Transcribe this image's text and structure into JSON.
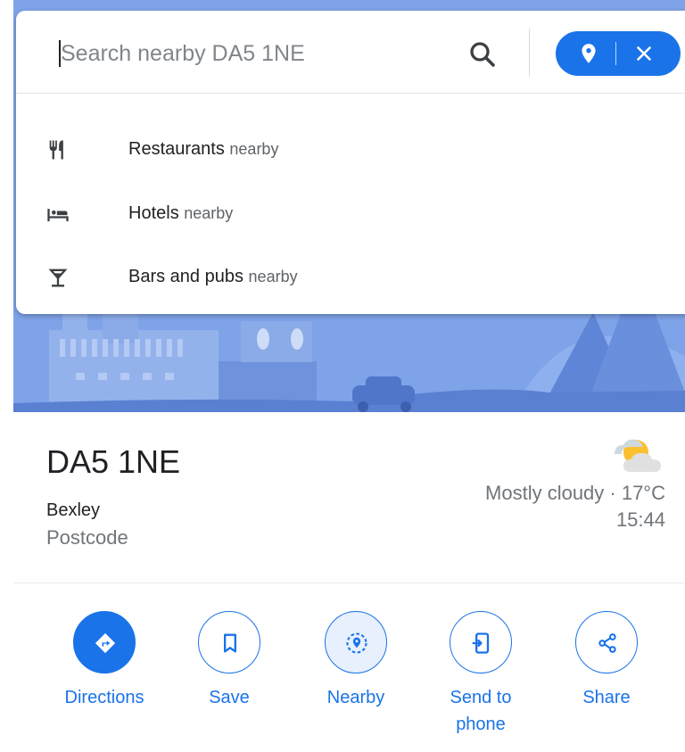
{
  "colors": {
    "accent": "#1a73e8",
    "hero_sky": "#7fa3e8",
    "text_primary": "#202124",
    "text_secondary": "#70757a"
  },
  "search": {
    "placeholder": "Search nearby DA5 1NE",
    "value": "",
    "search_icon": "search-icon",
    "pin_icon": "location-pin-icon",
    "close_icon": "close-icon"
  },
  "suggestions": [
    {
      "icon": "restaurant-icon",
      "label": "Restaurants",
      "suffix": "nearby"
    },
    {
      "icon": "hotel-icon",
      "label": "Hotels",
      "suffix": "nearby"
    },
    {
      "icon": "bar-icon",
      "label": "Bars and pubs",
      "suffix": "nearby"
    }
  ],
  "place": {
    "title": "DA5 1NE",
    "locality": "Bexley",
    "type": "Postcode"
  },
  "weather": {
    "icon": "partly-cloudy-icon",
    "summary": "Mostly cloudy · 17°C",
    "time": "15:44"
  },
  "actions": [
    {
      "icon": "directions-icon",
      "label": "Directions"
    },
    {
      "icon": "bookmark-icon",
      "label": "Save"
    },
    {
      "icon": "nearby-icon",
      "label": "Nearby"
    },
    {
      "icon": "send-to-phone-icon",
      "label": "Send to phone"
    },
    {
      "icon": "share-icon",
      "label": "Share"
    }
  ]
}
